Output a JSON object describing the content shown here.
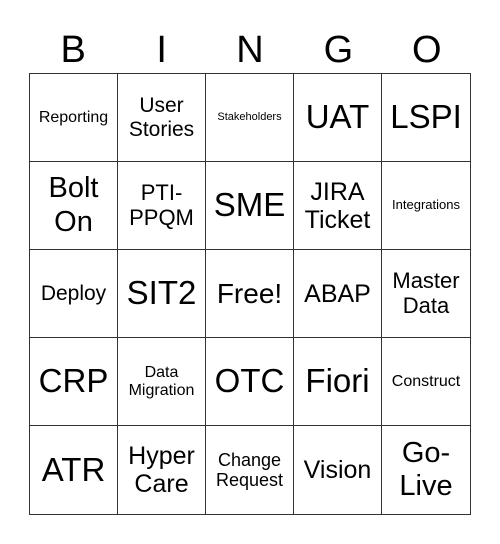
{
  "header": {
    "letters": [
      "B",
      "I",
      "N",
      "G",
      "O"
    ]
  },
  "card": {
    "cells": [
      "Reporting",
      "User Stories",
      "Stakeholders",
      "UAT",
      "LSPI",
      "Bolt On",
      "PTI-PPQM",
      "SME",
      "JIRA Ticket",
      "Integrations",
      "Deploy",
      "SIT2",
      "Free!",
      "ABAP",
      "Master Data",
      "CRP",
      "Data Migration",
      "OTC",
      "Fiori",
      "Construct",
      "ATR",
      "Hyper Care",
      "Change Request",
      "Vision",
      "Go-Live"
    ]
  }
}
